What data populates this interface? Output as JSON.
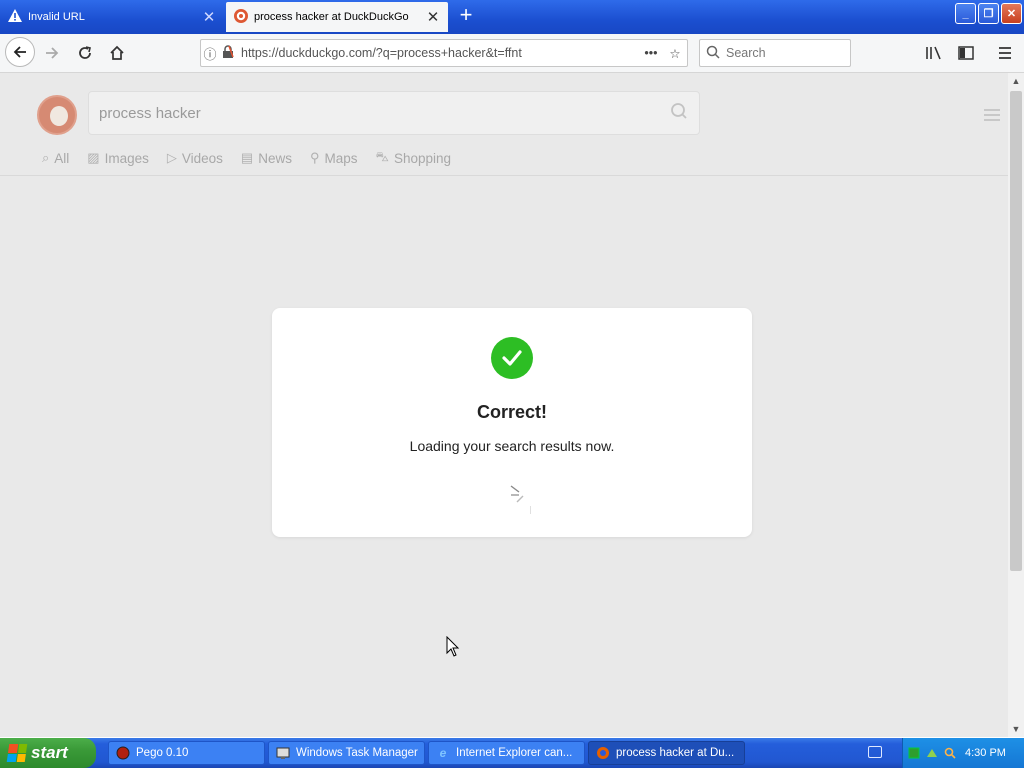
{
  "browser": {
    "tabs": [
      {
        "title": "Invalid URL",
        "active": false,
        "icon": "warning-icon"
      },
      {
        "title": "process hacker at DuckDuckGo",
        "active": true,
        "icon": "duckduckgo-icon"
      }
    ],
    "url": "https://duckduckgo.com/?q=process+hacker&t=ffnt",
    "search_placeholder": "Search"
  },
  "ddg": {
    "query": "process hacker",
    "tabs": [
      {
        "label": "All",
        "icon": "search-icon"
      },
      {
        "label": "Images",
        "icon": "image-icon"
      },
      {
        "label": "Videos",
        "icon": "play-icon"
      },
      {
        "label": "News",
        "icon": "newspaper-icon"
      },
      {
        "label": "Maps",
        "icon": "map-pin-icon"
      },
      {
        "label": "Shopping",
        "icon": "bag-icon"
      }
    ]
  },
  "modal": {
    "title": "Correct!",
    "subtitle": "Loading your search results now.",
    "accent": "#2dbe24"
  },
  "taskbar": {
    "start_label": "start",
    "tasks": [
      {
        "label": "Pego 0.10",
        "icon": "pego-icon",
        "active": false
      },
      {
        "label": "Windows Task Manager",
        "icon": "task-manager-icon",
        "active": false
      },
      {
        "label": "Internet Explorer can...",
        "icon": "ie-icon",
        "active": false
      },
      {
        "label": "process hacker at Du...",
        "icon": "firefox-icon",
        "active": true
      }
    ],
    "clock": "4:30 PM"
  }
}
